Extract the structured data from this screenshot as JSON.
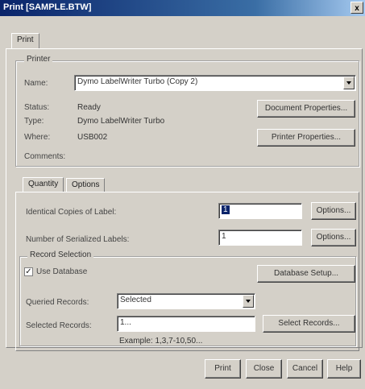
{
  "window": {
    "title": "Print [SAMPLE.BTW]",
    "close_glyph": "x"
  },
  "tabs": {
    "main": "Print",
    "sub_quantity": "Quantity",
    "sub_options": "Options"
  },
  "printer": {
    "group_label": "Printer",
    "name_label": "Name:",
    "name_value": "Dymo LabelWriter Turbo (Copy 2)",
    "status_label": "Status:",
    "status_value": "Ready",
    "type_label": "Type:",
    "type_value": "Dymo LabelWriter Turbo",
    "where_label": "Where:",
    "where_value": "USB002",
    "comments_label": "Comments:",
    "doc_props_button": "Document Properties...",
    "printer_props_button": "Printer Properties..."
  },
  "quantity": {
    "identical_label": "Identical Copies of Label:",
    "identical_value": "1",
    "serialized_label": "Number of Serialized Labels:",
    "serialized_value": "1",
    "options_button": "Options..."
  },
  "record_selection": {
    "group_label": "Record Selection",
    "use_database_label": "Use Database",
    "use_database_checked": true,
    "database_setup_button": "Database Setup...",
    "queried_label": "Queried Records:",
    "queried_value": "Selected",
    "selected_label": "Selected Records:",
    "selected_value": "1...",
    "select_records_button": "Select Records...",
    "example_text": "Example: 1,3,7-10,50..."
  },
  "footer": {
    "print": "Print",
    "close": "Close",
    "cancel": "Cancel",
    "help": "Help"
  }
}
